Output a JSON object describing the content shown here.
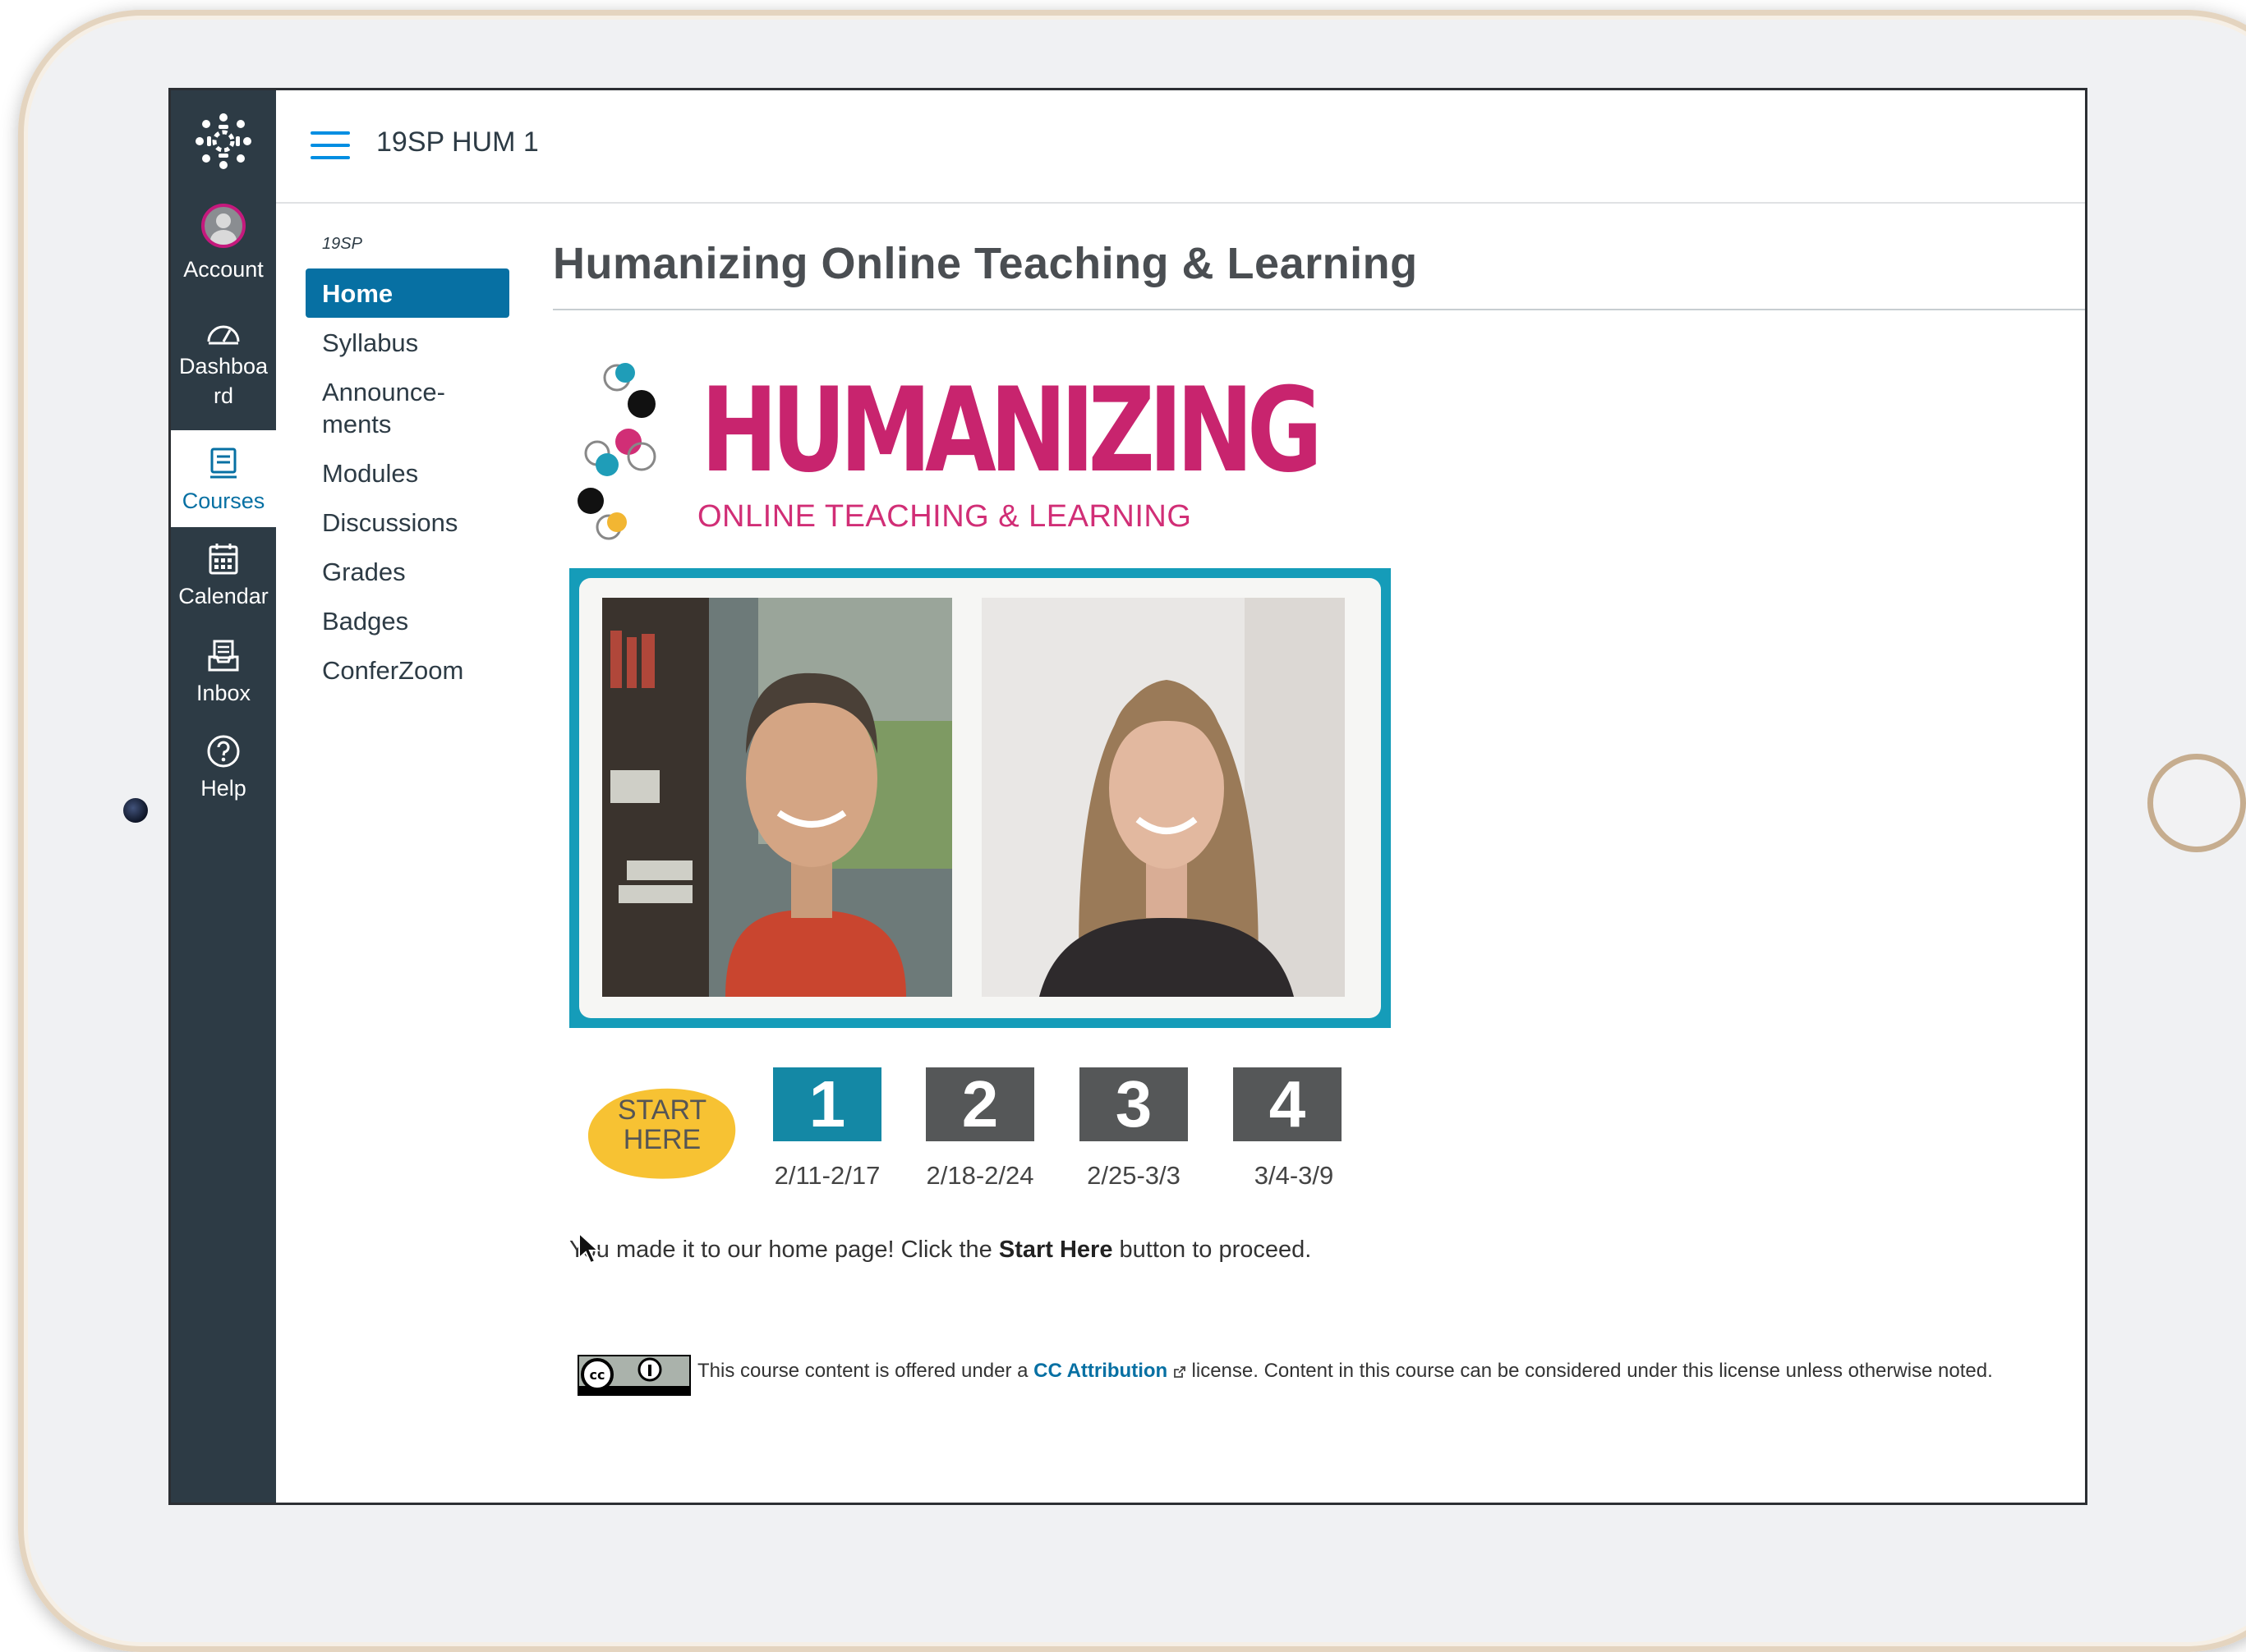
{
  "global_nav": {
    "items": [
      {
        "label": "Account",
        "icon": "user-avatar-icon"
      },
      {
        "label": "Dashboa\nrd",
        "icon": "dashboard-gauge-icon"
      },
      {
        "label": "Courses",
        "icon": "courses-book-icon",
        "active": true
      },
      {
        "label": "Calendar",
        "icon": "calendar-icon"
      },
      {
        "label": "Inbox",
        "icon": "inbox-tray-icon"
      },
      {
        "label": "Help",
        "icon": "help-circle-icon"
      }
    ],
    "background": "#2d3b45",
    "accent": "#0770a3"
  },
  "header": {
    "course_title": "19SP HUM 1"
  },
  "course_nav": {
    "term": "19SP",
    "items": [
      {
        "label": "Home",
        "active": true
      },
      {
        "label": "Syllabus"
      },
      {
        "label": "Announce-\nments"
      },
      {
        "label": "Modules"
      },
      {
        "label": "Discussions"
      },
      {
        "label": "Grades"
      },
      {
        "label": "Badges"
      },
      {
        "label": "ConferZoom"
      }
    ]
  },
  "page": {
    "title": "Humanizing Online Teaching & Learning",
    "banner": {
      "word": "HUMANIZING",
      "subword": "ONLINE TEACHING & LEARNING",
      "color": "#c8246e"
    },
    "start_button": {
      "line1": "START",
      "line2": "HERE",
      "color": "#f7c233"
    },
    "weeks": [
      {
        "number": "1",
        "dates": "2/11-2/17",
        "current": true
      },
      {
        "number": "2",
        "dates": "2/18-2/24"
      },
      {
        "number": "3",
        "dates": "2/25-3/3"
      },
      {
        "number": "4",
        "dates": "3/4-3/9"
      }
    ],
    "intro": {
      "before": "You made it to our home page! Click the ",
      "bold": "Start Here",
      "after": " button to proceed."
    },
    "license": {
      "before": "This course content is offered under a ",
      "link": "CC Attribution",
      "after": " license. Content in this course can be considered under this license unless otherwise noted."
    }
  }
}
